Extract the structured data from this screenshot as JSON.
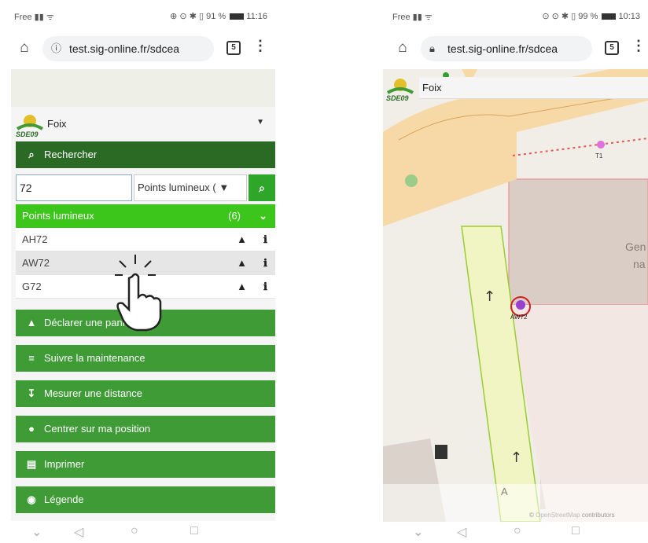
{
  "left": {
    "status": {
      "carrier": "Free",
      "right": "⊕ ⊙ ✱ ▯ 91 % ",
      "time": "11:16"
    },
    "browser": {
      "url": "test.sig-online.fr/sdcea",
      "tabs": "5"
    },
    "place": "Foix",
    "search_label": "Rechercher",
    "search_value": "72",
    "layer_select": "Points lumineux (",
    "results": {
      "label": "Points lumineux",
      "count": "(6)",
      "rows": [
        "AH72",
        "AW72",
        "G72"
      ]
    },
    "menu": [
      "Déclarer une panne",
      "Suivre la maintenance",
      "Mesurer une distance",
      "Centrer sur ma position",
      "Imprimer",
      "Légende"
    ]
  },
  "right": {
    "status": {
      "carrier": "Free",
      "right": "⊙ ⊙ ✱ ▯ 99 % ",
      "time": "10:13"
    },
    "browser": {
      "url": "test.sig-online.fr/sdcea",
      "tabs": "5"
    },
    "place": "Foix",
    "map": {
      "label_t1": "T1",
      "label_aw72": "AW72",
      "label_gen": "Gen",
      "label_na": "na",
      "road_label": "A",
      "attribution_link": "OpenStreetMap",
      "attribution_text": " contributors"
    }
  },
  "icons": [
    "home-icon",
    "info-icon",
    "lock-icon",
    "kebab-icon",
    "search-icon",
    "chevron-down-icon",
    "warning-icon",
    "list-icon",
    "pin-icon",
    "location-icon",
    "print-icon",
    "legend-icon",
    "light-marker-icon",
    "hand-cursor-icon"
  ]
}
